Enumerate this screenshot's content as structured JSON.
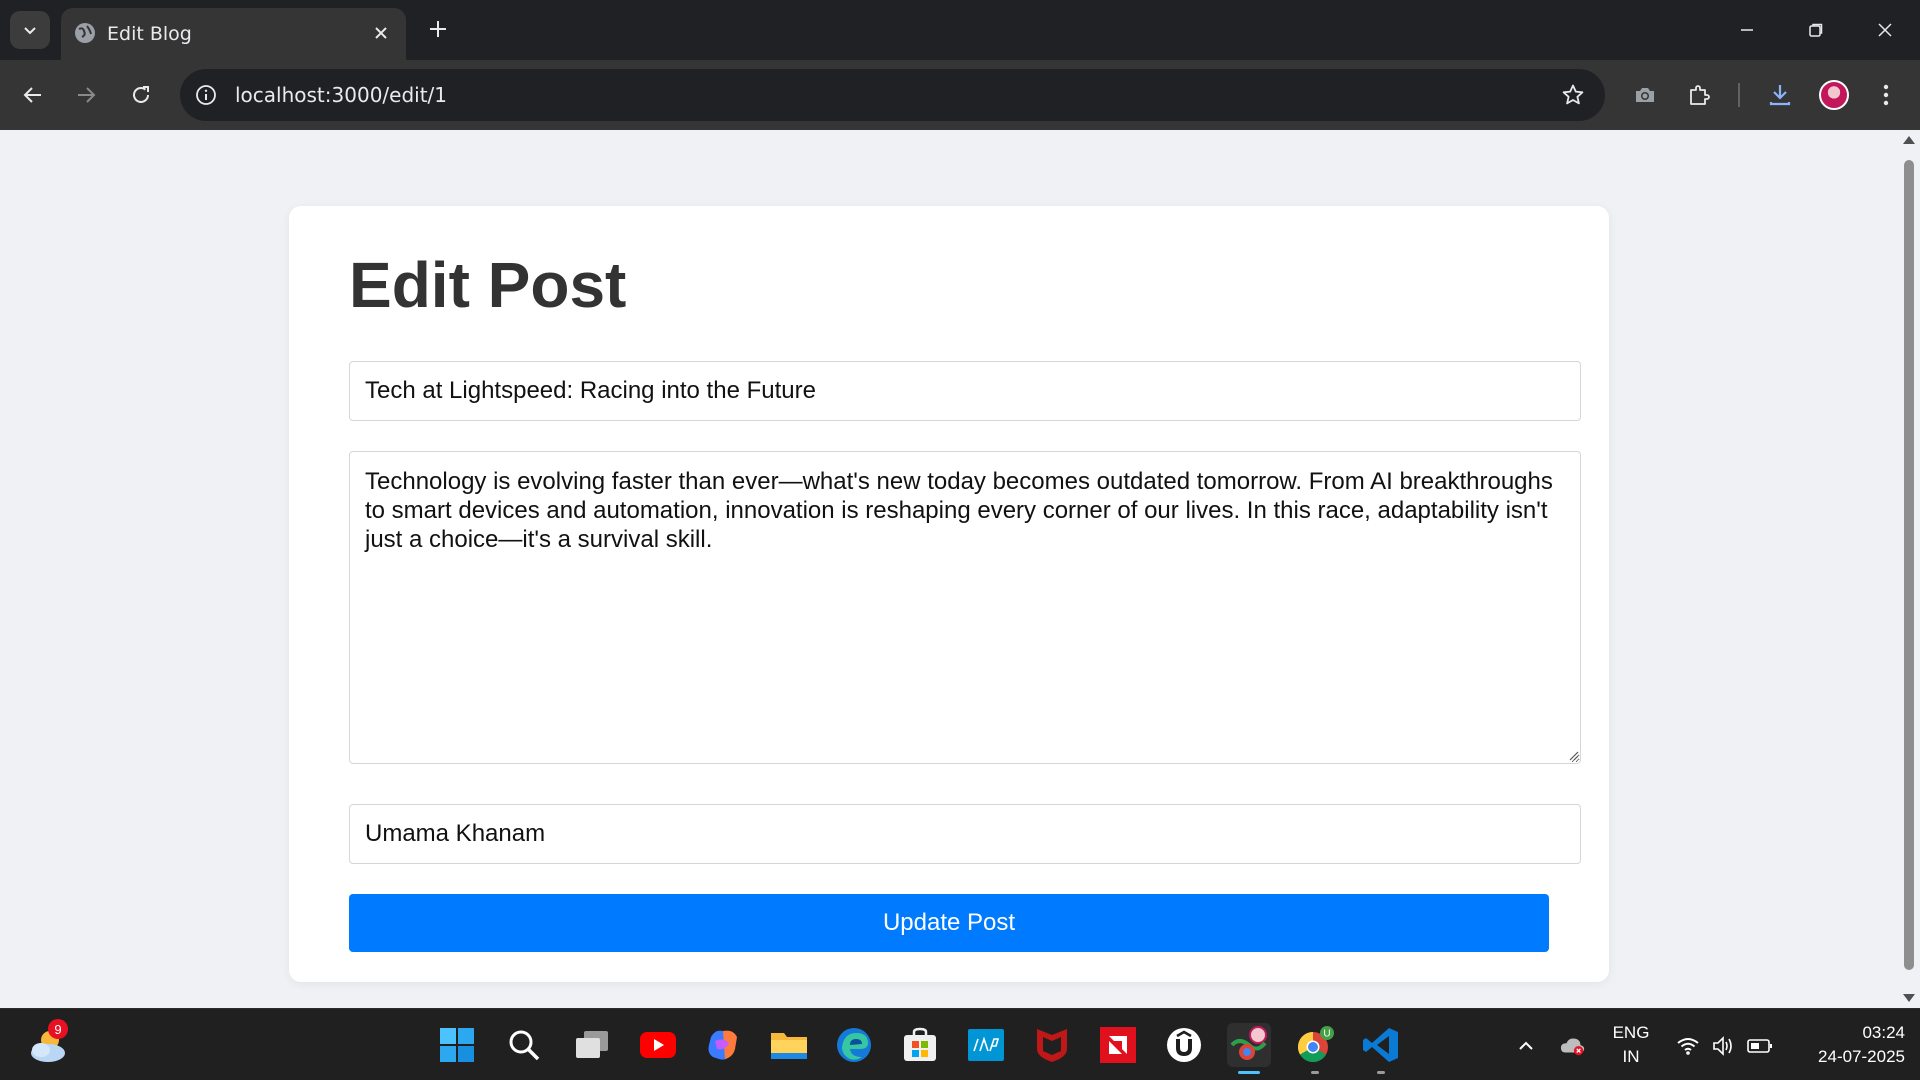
{
  "browser": {
    "tab": {
      "title": "Edit Blog"
    },
    "url": "localhost:3000/edit/1"
  },
  "page": {
    "heading": "Edit Post",
    "form": {
      "title_value": "Tech at Lightspeed: Racing into the Future",
      "content_value": "Technology is evolving faster than ever—what's new today becomes outdated tomorrow. From AI breakthroughs to smart devices and automation, innovation is reshaping every corner of our lives. In this race, adaptability isn't just a choice—it's a survival skill.",
      "author_value": "Umama Khanam",
      "submit_label": "Update Post"
    },
    "colors": {
      "accent": "#007bff",
      "background": "#f0f1f5"
    }
  },
  "taskbar": {
    "weather_badge": "9",
    "language_line1": "ENG",
    "language_line2": "IN",
    "time": "03:24",
    "date": "24-07-2025",
    "apps": [
      "start-icon",
      "search-icon",
      "task-view-icon",
      "youtube-icon",
      "copilot-icon",
      "file-explorer-icon",
      "edge-icon",
      "microsoft-store-icon",
      "myhp-icon",
      "mcafee-icon",
      "amd-icon",
      "udemy-icon",
      "chrome-profile-icon",
      "chrome-icon",
      "vscode-icon"
    ]
  }
}
